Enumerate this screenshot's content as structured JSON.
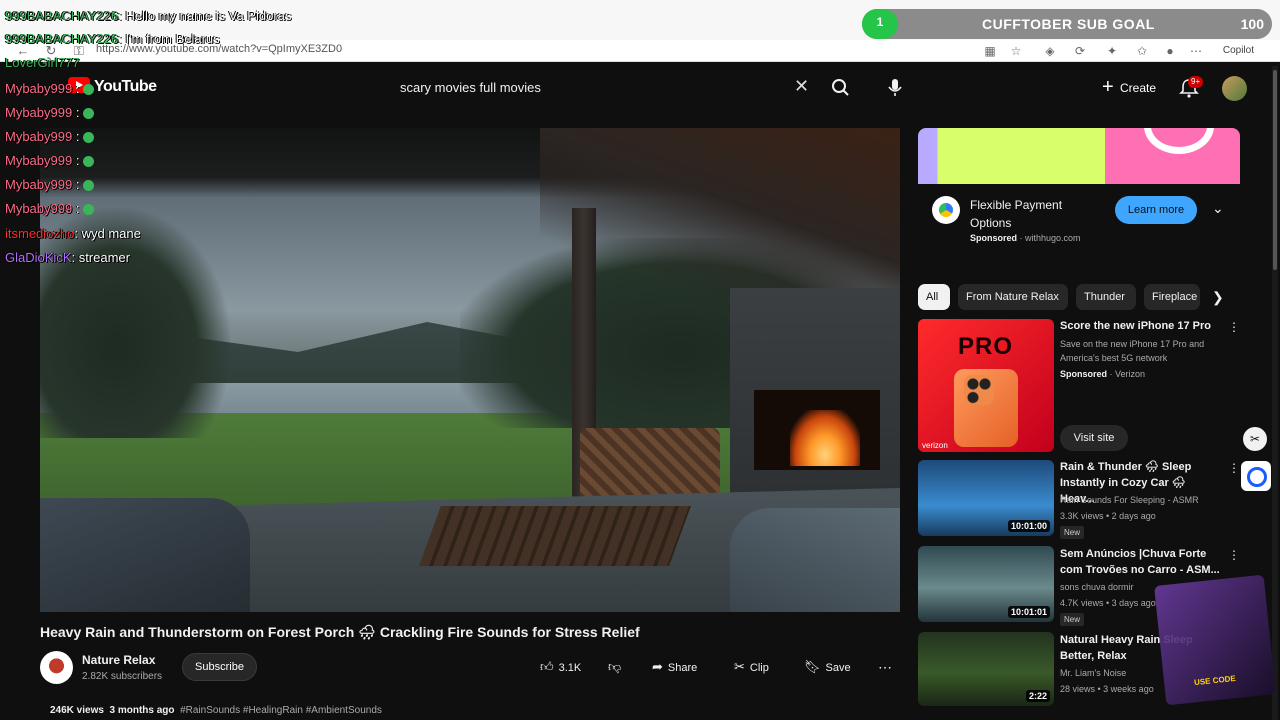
{
  "browser": {
    "url": "https://www.youtube.com/watch?v=QpImyXE3ZD0",
    "copilot_label": "Copilot"
  },
  "sub_goal": {
    "title": "CUFFTOBER SUB GOAL",
    "current": "1",
    "target": "100",
    "progress_fraction": 0.01
  },
  "chat": [
    {
      "user": "999BABACHAY226",
      "text": ": Hello my name is Va Pidoras",
      "user_color": "#3bb55a"
    },
    {
      "user": "999BABACHAY226",
      "text": ": I'm from Belarus",
      "user_color": "#3bb55a"
    },
    {
      "user": "LoverGirl777",
      "text": "",
      "user_color": "#3bb55a"
    },
    {
      "user": "Mybaby999",
      "text": " : ",
      "user_color": "#ff6b8a"
    },
    {
      "user": "Mybaby999",
      "text": " : ",
      "user_color": "#ff6b8a"
    },
    {
      "user": "Mybaby999",
      "text": " : ",
      "user_color": "#ff6b8a"
    },
    {
      "user": "Mybaby999",
      "text": " : ",
      "user_color": "#ff6b8a"
    },
    {
      "user": "Mybaby999",
      "text": " : ",
      "user_color": "#ff6b8a"
    },
    {
      "user": "Mybaby999",
      "text": " : ",
      "user_color": "#ff6b8a"
    },
    {
      "user": "itsmediozho",
      "text": ": wyd mane",
      "user_color": "#ff2d2d"
    },
    {
      "user": "GlaDioKicK",
      "text": ": streamer",
      "user_color": "#b46bff"
    }
  ],
  "header": {
    "logo_text": "YouTube",
    "search_value": "scary movies full movies",
    "create_label": "Create",
    "notif_badge": "9+"
  },
  "video": {
    "title": "Heavy Rain and Thunderstorm on Forest Porch 🌧 Crackling Fire Sounds for Stress Relief",
    "channel": "Nature Relax",
    "subscribers": "2.82K subscribers",
    "subscribe_label": "Subscribe",
    "likes": "3.1K",
    "share_label": "Share",
    "clip_label": "Clip",
    "save_label": "Save",
    "views": "246K views",
    "age": "3 months ago",
    "tags": "#RainSounds #HealingRain #AmbientSounds"
  },
  "ad": {
    "title": "Flexible Payment Options",
    "sponsored_label": "Sponsored",
    "domain": "withhugo.com",
    "cta_label": "Learn more"
  },
  "chips": [
    "All",
    "From Nature Relax",
    "Thunder",
    "Fireplace"
  ],
  "recommendations": [
    {
      "title": "Score the new iPhone 17 Pro",
      "line1": "Save on the new iPhone 17 Pro and America's best 5G network",
      "sponsor_label": "Sponsored",
      "advertiser": "Verizon",
      "cta_label": "Visit site",
      "thumb_text": "PRO",
      "thumb_brand": "verizon"
    },
    {
      "title": "Rain & Thunder 🌧 Sleep Instantly in Cozy Car 🌧 Heav...",
      "channel": "Rain Sounds For Sleeping - ASMR",
      "meta": "3.3K views • 2 days ago",
      "badge": "New",
      "duration": "10:01:00"
    },
    {
      "title": "Sem Anúncios |Chuva Forte com Trovões no Carro - ASM...",
      "channel": "sons chuva dormir",
      "meta": "4.7K views • 3 days ago",
      "badge": "New",
      "duration": "10:01:01"
    },
    {
      "title": "Natural Heavy Rain Sleep Better, Relax",
      "channel": "Mr. Liam's Noise",
      "meta": "28 views • 3 weeks ago",
      "badge": "",
      "duration": "2:22"
    }
  ],
  "overlay": {
    "promo_text": "USE CODE"
  },
  "colors": {
    "accent_red": "#ff0000",
    "learn_more_blue": "#3ea6ff",
    "sub_goal_green": "#25c54a"
  }
}
